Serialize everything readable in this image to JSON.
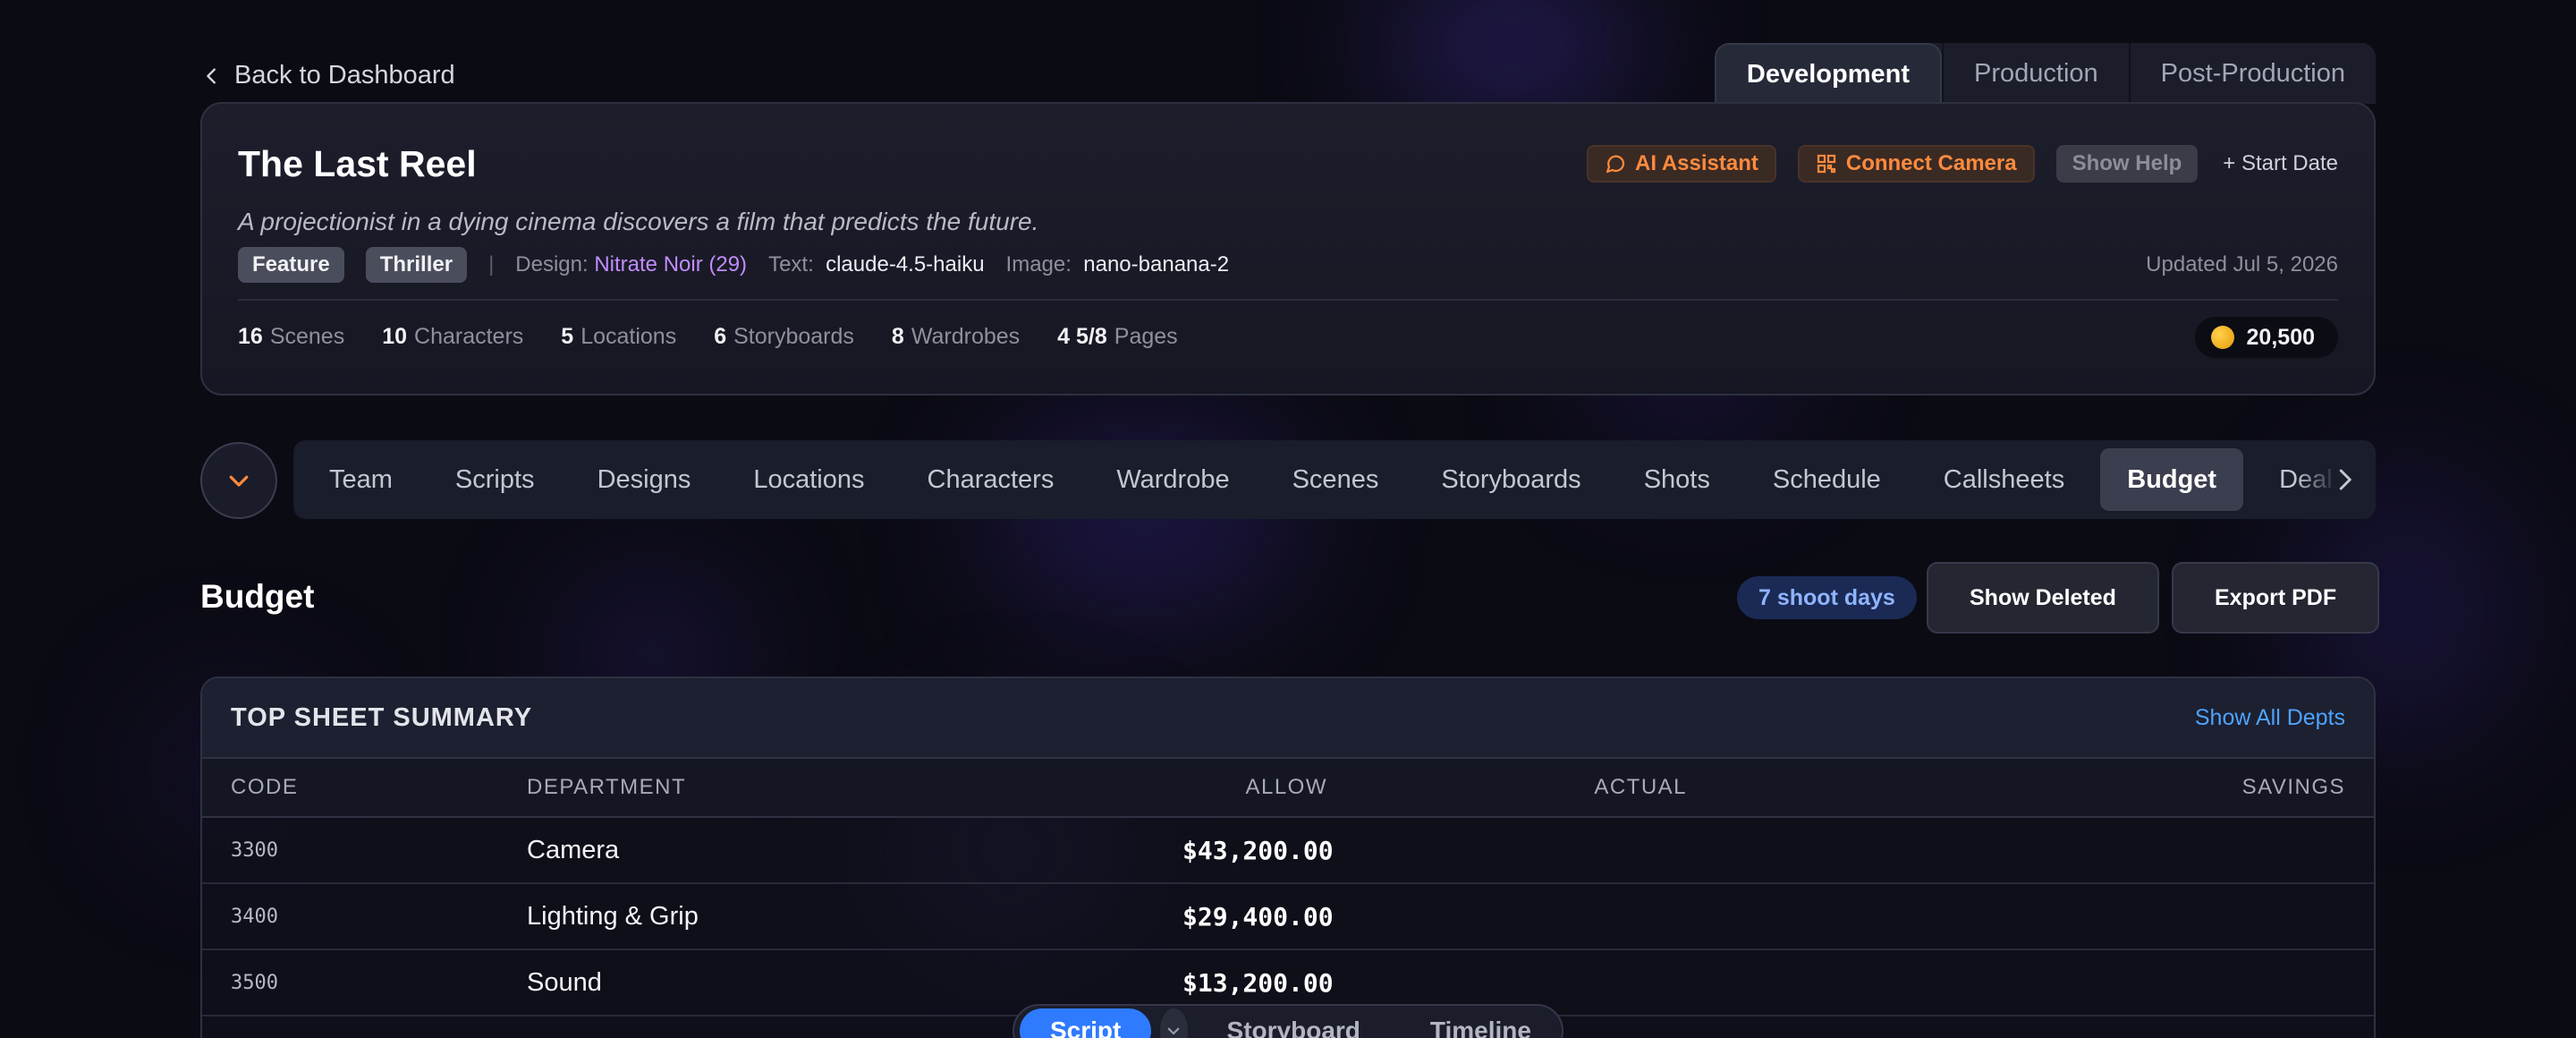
{
  "back_link": "Back to Dashboard",
  "stage_tabs": [
    {
      "label": "Development",
      "active": true
    },
    {
      "label": "Production",
      "active": false
    },
    {
      "label": "Post-Production",
      "active": false
    }
  ],
  "project": {
    "title": "The Last Reel",
    "logline": "A projectionist in a dying cinema discovers a film that predicts the future.",
    "tags": [
      "Feature",
      "Thriller"
    ],
    "design_label": "Design:",
    "design_value": "Nitrate Noir (29)",
    "text_label": "Text:",
    "text_value": "claude-4.5-haiku",
    "image_label": "Image:",
    "image_value": "nano-banana-2",
    "updated": "Updated Jul 5, 2026",
    "actions": {
      "ai_assistant": "AI Assistant",
      "connect_camera": "Connect Camera",
      "show_help": "Show Help",
      "start_date": "+ Start Date"
    },
    "stats": [
      {
        "value": "16",
        "label": "Scenes"
      },
      {
        "value": "10",
        "label": "Characters"
      },
      {
        "value": "5",
        "label": "Locations"
      },
      {
        "value": "6",
        "label": "Storyboards"
      },
      {
        "value": "8",
        "label": "Wardrobes"
      },
      {
        "value": "4 5/8",
        "label": "Pages"
      }
    ],
    "credits": "20,500"
  },
  "nav": {
    "items": [
      "Team",
      "Scripts",
      "Designs",
      "Locations",
      "Characters",
      "Wardrobe",
      "Scenes",
      "Storyboards",
      "Shots",
      "Schedule",
      "Callsheets",
      "Budget",
      "Deal"
    ],
    "active": "Budget"
  },
  "budget": {
    "title": "Budget",
    "shoot_days": "7 shoot days",
    "show_deleted": "Show Deleted",
    "export_pdf": "Export PDF",
    "summary_title": "TOP SHEET SUMMARY",
    "show_all": "Show All Depts",
    "columns": {
      "code": "CODE",
      "department": "DEPARTMENT",
      "allow": "ALLOW",
      "actual": "ACTUAL",
      "savings": "SAVINGS"
    },
    "rows": [
      {
        "code": "3300",
        "department": "Camera",
        "allow": "$43,200.00",
        "actual": "",
        "savings": ""
      },
      {
        "code": "3400",
        "department": "Lighting & Grip",
        "allow": "$29,400.00",
        "actual": "",
        "savings": ""
      },
      {
        "code": "3500",
        "department": "Sound",
        "allow": "$13,200.00",
        "actual": "",
        "savings": ""
      }
    ]
  },
  "bottom_bar": {
    "items": [
      {
        "label": "Script",
        "active": true
      },
      {
        "label": "Storyboard",
        "active": false
      },
      {
        "label": "Timeline",
        "active": false
      }
    ]
  },
  "colors": {
    "accent_orange": "#ff8a3d",
    "accent_blue": "#2f7bff",
    "link_blue": "#4ea3ff",
    "purple": "#c18cff"
  }
}
